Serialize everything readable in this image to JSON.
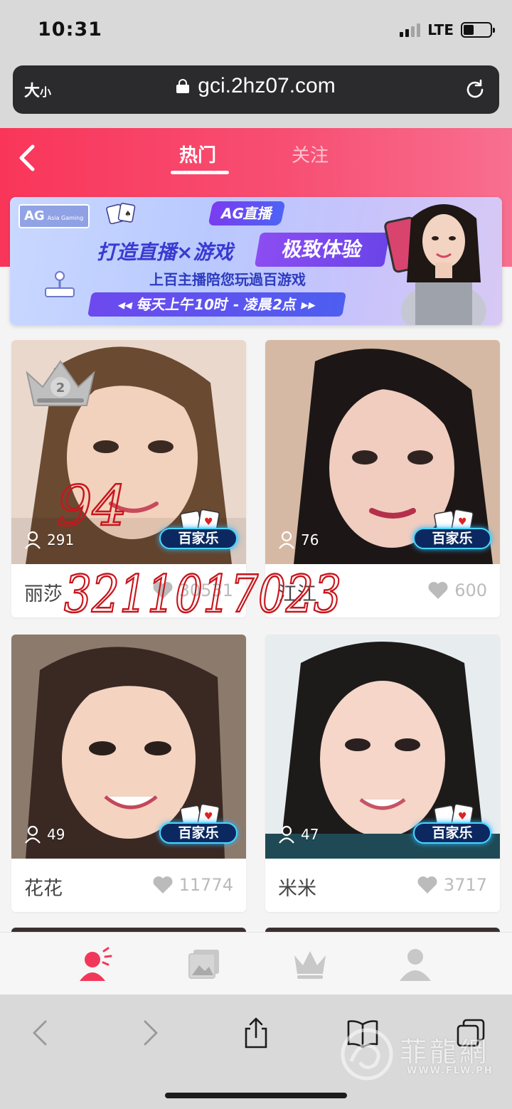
{
  "status_bar": {
    "time": "10:31",
    "network": "LTE"
  },
  "browser": {
    "text_size_label_big": "大",
    "text_size_label_small": "小",
    "url": "gci.2hz07.com"
  },
  "header": {
    "tabs": [
      {
        "label": "热门",
        "active": true
      },
      {
        "label": "关注",
        "active": false
      }
    ]
  },
  "banner": {
    "logo": "AG",
    "logo_sub": "Asia Gaming",
    "tag": "AG直播",
    "slogan_left": "打造直播×游戏",
    "slogan_right": "极致体验",
    "subtitle": "上百主播陪您玩過百游戏",
    "hours": "◂◂ 每天上午10时 - 凌晨2点 ▸▸"
  },
  "streamers": [
    {
      "name": "丽莎",
      "viewers": "291",
      "likes": "30531",
      "game_badge": "百家乐",
      "rank": "2",
      "hair": "#6b4a32",
      "skin": "#f3d2bd",
      "bg": "#ead8cc"
    },
    {
      "name": "江江",
      "viewers": "76",
      "likes": "600",
      "game_badge": "百家乐",
      "hair": "#1c1716",
      "skin": "#f1cdbf",
      "bg": "#d6b9a4"
    },
    {
      "name": "花花",
      "viewers": "49",
      "likes": "11774",
      "game_badge": "百家乐",
      "hair": "#3a2823",
      "skin": "#f4d3c0",
      "bg": "#8c7a6c"
    },
    {
      "name": "米米",
      "viewers": "47",
      "likes": "3717",
      "game_badge": "百家乐",
      "hair": "#1d1a1a",
      "skin": "#f5d6c8",
      "bg": "#e7ecef"
    }
  ],
  "handwritten": {
    "line1": "94",
    "line2": "3211017023"
  },
  "watermark": {
    "text": "菲龍網",
    "url": "WWW.FLW.PH"
  },
  "colors": {
    "brand": "#f9365a",
    "active_tab_icon": "#f2385a",
    "inactive_icon": "#c8c8c8",
    "badge_glow": "#4ad5ff"
  },
  "icons": {
    "app_tabbar": [
      "live-streamer-icon",
      "gallery-icon",
      "crown-icon",
      "profile-icon"
    ],
    "safari_toolbar": [
      "back-icon",
      "forward-icon",
      "share-icon",
      "bookmarks-icon",
      "tabs-icon"
    ]
  }
}
